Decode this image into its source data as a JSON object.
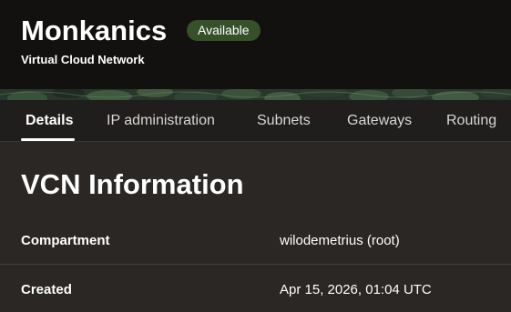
{
  "resource": {
    "name": "Monkanics",
    "status": "Available",
    "type_label": "Virtual Cloud Network"
  },
  "colors": {
    "status_badge": "#36502a",
    "banner_green": "#27372b",
    "background": "#2a2725"
  },
  "tabs": [
    {
      "label": "Details",
      "active": true
    },
    {
      "label": "IP administration",
      "active": false
    },
    {
      "label": "Subnets",
      "active": false
    },
    {
      "label": "Gateways",
      "active": false
    },
    {
      "label": "Routing",
      "active": false
    }
  ],
  "section": {
    "title": "VCN Information"
  },
  "info": [
    {
      "label": "Compartment",
      "value": "wilodemetrius (root)"
    },
    {
      "label": "Created",
      "value": "Apr 15, 2026, 01:04 UTC"
    }
  ]
}
